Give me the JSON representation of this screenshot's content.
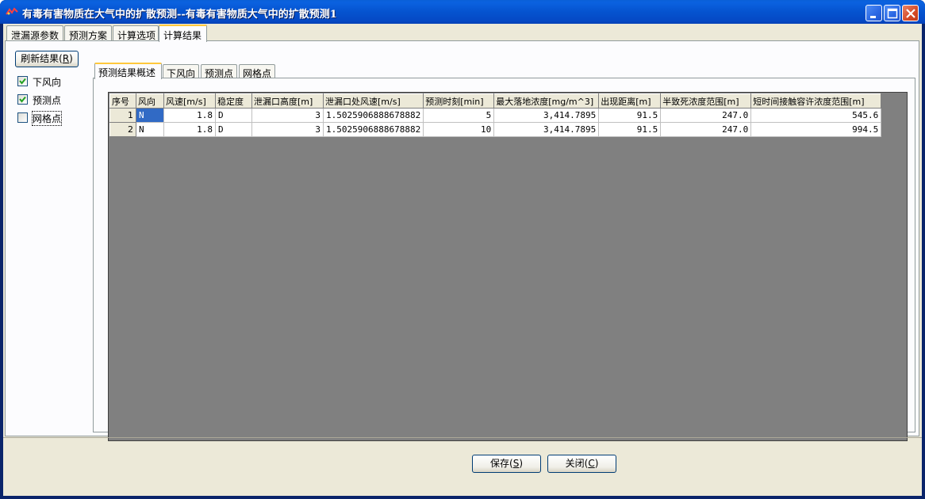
{
  "window": {
    "title": "有毒有害物质在大气中的扩散预测--有毒有害物质大气中的扩散预测1"
  },
  "tabs": [
    "泄漏源参数",
    "预测方案",
    "计算选项",
    "计算结果"
  ],
  "sidebar": {
    "refresh_label": "刷新结果",
    "refresh_key": "R",
    "checkboxes": [
      {
        "label": "下风向",
        "checked": true
      },
      {
        "label": "预测点",
        "checked": true
      },
      {
        "label": "网格点",
        "checked": false
      }
    ]
  },
  "inner_tabs": [
    "预测结果概述",
    "下风向",
    "预测点",
    "网格点"
  ],
  "table": {
    "headers": [
      "序号",
      "风向",
      "风速[m/s]",
      "稳定度",
      "泄漏口高度[m]",
      "泄漏口处风速[m/s]",
      "预测时刻[min]",
      "最大落地浓度[mg/m^3]",
      "出现距离[m]",
      "半致死浓度范围[m]",
      "短时间接触容许浓度范围[m]"
    ],
    "rows": [
      [
        "1",
        "N",
        "1.8",
        "D",
        "3",
        "1.5025906888678882",
        "5",
        "3,414.7895",
        "91.5",
        "247.0",
        "545.6"
      ],
      [
        "2",
        "N",
        "1.8",
        "D",
        "3",
        "1.5025906888678882",
        "10",
        "3,414.7895",
        "91.5",
        "247.0",
        "994.5"
      ]
    ]
  },
  "buttons": {
    "save_label": "保存",
    "save_key": "S",
    "close_label": "关闭",
    "close_key": "C"
  },
  "colors": {
    "titlebar": "#0553cf",
    "panel": "#ece9d8",
    "grid_bg": "#808080",
    "selection": "#316ac5",
    "active_tab_accent": "#ffc83c"
  }
}
